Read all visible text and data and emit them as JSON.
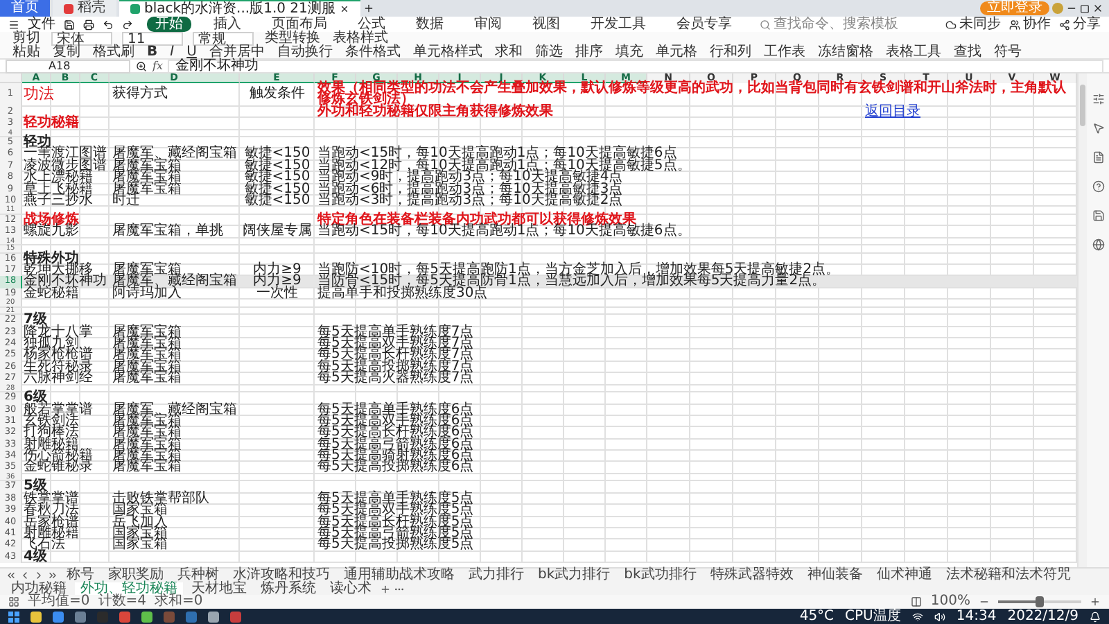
{
  "title_tabs": [
    {
      "label": "首页",
      "selected": false,
      "kind": "home"
    },
    {
      "label": "稻壳",
      "selected": false,
      "kind": "app"
    },
    {
      "label": "black的水浒资...版1.0 21测服",
      "selected": true,
      "kind": "doc"
    }
  ],
  "login_button": "立即登录",
  "menu": {
    "file": "文件",
    "tabs": [
      {
        "label": "开始",
        "selected": true
      },
      {
        "label": "插入",
        "selected": false
      },
      {
        "label": "页面布局",
        "selected": false
      },
      {
        "label": "公式",
        "selected": false
      },
      {
        "label": "数据",
        "selected": false
      },
      {
        "label": "审阅",
        "selected": false
      },
      {
        "label": "视图",
        "selected": false
      },
      {
        "label": "开发工具",
        "selected": false
      },
      {
        "label": "会员专享",
        "selected": false
      }
    ],
    "search": "查找命令、搜索模板",
    "actions": [
      "未同步",
      "协作",
      "分享"
    ]
  },
  "ribbon": {
    "row_1": [
      {
        "kind": "button",
        "label": "剪切"
      },
      {
        "kind": "field",
        "label": "宋体"
      },
      {
        "kind": "field",
        "label": "11"
      },
      {
        "kind": "field",
        "label": "常规"
      },
      {
        "kind": "button",
        "label": "类型转换"
      },
      {
        "kind": "button",
        "label": "表格样式"
      }
    ],
    "row_2": [
      {
        "kind": "button",
        "label": "粘贴"
      },
      {
        "kind": "button",
        "label": "复制"
      },
      {
        "kind": "button",
        "label": "格式刷"
      },
      {
        "kind": "bold",
        "label": "B"
      },
      {
        "kind": "italic",
        "label": "I"
      },
      {
        "kind": "underline",
        "label": "U"
      },
      {
        "kind": "button",
        "label": "合并居中"
      },
      {
        "kind": "button",
        "label": "自动换行"
      },
      {
        "kind": "button",
        "label": "条件格式"
      },
      {
        "kind": "button",
        "label": "单元格样式"
      },
      {
        "kind": "button",
        "label": "求和"
      },
      {
        "kind": "button",
        "label": "筛选"
      },
      {
        "kind": "button",
        "label": "排序"
      },
      {
        "kind": "button",
        "label": "填充"
      },
      {
        "kind": "button",
        "label": "单元格"
      },
      {
        "kind": "button",
        "label": "行和列"
      },
      {
        "kind": "button",
        "label": "工作表"
      },
      {
        "kind": "button",
        "label": "冻结窗格"
      },
      {
        "kind": "button",
        "label": "表格工具"
      },
      {
        "kind": "button",
        "label": "查找"
      },
      {
        "kind": "button",
        "label": "符号"
      }
    ]
  },
  "formula_bar": {
    "name_box": "A18",
    "function_label": "fx",
    "value": "金刚不坏神功"
  },
  "columns": [
    {
      "label": "A",
      "selected": true
    },
    {
      "label": "B",
      "selected": true
    },
    {
      "label": "C",
      "selected": true
    },
    {
      "label": "D",
      "selected": true
    },
    {
      "label": "E",
      "selected": true
    },
    {
      "label": "F",
      "selected": true
    },
    {
      "label": "G",
      "selected": true
    },
    {
      "label": "H",
      "selected": true
    },
    {
      "label": "I",
      "selected": true
    },
    {
      "label": "J",
      "selected": true
    },
    {
      "label": "K",
      "selected": true
    },
    {
      "label": "L",
      "selected": true
    },
    {
      "label": "M",
      "selected": true
    },
    {
      "label": "N",
      "selected": false
    },
    {
      "label": "O",
      "selected": false
    },
    {
      "label": "P",
      "selected": false
    },
    {
      "label": "Q",
      "selected": false
    },
    {
      "label": "R",
      "selected": false
    },
    {
      "label": "S",
      "selected": false
    },
    {
      "label": "T",
      "selected": false
    },
    {
      "label": "U",
      "selected": false
    },
    {
      "label": "V",
      "selected": false
    },
    {
      "label": "W",
      "selected": false
    }
  ],
  "rows": [
    {
      "num": "1",
      "kind": "title",
      "selected": false,
      "a": "功法",
      "d": "获得方式",
      "e": "触发条件",
      "f": "效果（相同类型的功法不会产生叠加效果，默认修炼等级更高的武功，比如当背包同时有玄铁剑谱和开山斧法时，主角默认修炼玄铁剑法）"
    },
    {
      "num": "2",
      "kind": "link",
      "selected": false,
      "f": "外功和轻功秘籍仅限主角获得修炼效果",
      "link": "返回目录"
    },
    {
      "num": "3",
      "kind": "section",
      "selected": false,
      "a": "轻功秘籍"
    },
    {
      "num": "4",
      "kind": "empty",
      "selected": false
    },
    {
      "num": "5",
      "kind": "group",
      "selected": false,
      "a": "轻功"
    },
    {
      "num": "6",
      "kind": "item",
      "selected": false,
      "a": "一苇渡江图谱",
      "d": "屠魔军、藏经阁宝箱",
      "e": "敏捷<150",
      "f": "当跑动<15时，每10天提高跑动1点；每10天提高敏捷6点"
    },
    {
      "num": "7",
      "kind": "item",
      "selected": false,
      "a": "凌波微步图谱",
      "d": "屠魔军宝箱",
      "e": "敏捷<150",
      "f": "当跑动<12时，每10天提高跑动1点；每10天提高敏捷5点。"
    },
    {
      "num": "8",
      "kind": "item",
      "selected": false,
      "a": "水上漂秘籍",
      "d": "屠魔军宝箱",
      "e": "敏捷<150",
      "f": "当跑动<9时，提高跑动3点；每10天提高敏捷4点"
    },
    {
      "num": "9",
      "kind": "item",
      "selected": false,
      "a": "草上飞秘籍",
      "d": "屠魔军宝箱",
      "e": "敏捷<150",
      "f": "当跑动<6时，提高跑动3点；每10天提高敏捷3点"
    },
    {
      "num": "10",
      "kind": "item",
      "selected": false,
      "a": "燕子三抄水",
      "d": "时迁",
      "e": "敏捷<150",
      "f": "当跑动<3时，提高跑动3点；每10天提高敏捷2点"
    },
    {
      "num": "11",
      "kind": "empty",
      "selected": false
    },
    {
      "num": "12",
      "kind": "section",
      "selected": false,
      "a": "战场修炼",
      "f": "特定角色在装备栏装备内功武功都可以获得修炼效果"
    },
    {
      "num": "13",
      "kind": "item",
      "selected": false,
      "a": "螺旋九影",
      "d": "屠魔军宝箱，单挑",
      "e": "阔侠屋专属",
      "f": "当跑动<15时，每10天提高跑动1点；每10天提高敏捷6点。"
    },
    {
      "num": "14",
      "kind": "empty",
      "selected": false
    },
    {
      "num": "15",
      "kind": "empty",
      "selected": false
    },
    {
      "num": "16",
      "kind": "group",
      "selected": false,
      "a": "特殊外功"
    },
    {
      "num": "17",
      "kind": "item",
      "selected": false,
      "a": "乾坤大挪移",
      "d": "屠魔军宝箱",
      "e": "内力≥9",
      "f": "当跑防<10时，每5天提高跑防1点，当方金芝加入后，增加效果每5天提高敏捷2点。"
    },
    {
      "num": "18",
      "kind": "item",
      "selected": true,
      "a": "金刚不坏神功",
      "d": "屠魔军、藏经阁宝箱",
      "e": "内力≥9",
      "f": "当防骨<15时，每5天提高防骨1点，当慧远加入后，增加效果每5天提高力量2点。"
    },
    {
      "num": "19",
      "kind": "item",
      "selected": false,
      "a": "金蛇秘籍",
      "d": "阿诗玛加入",
      "e": "一次性",
      "f": "提高单手和投掷熟练度30点"
    },
    {
      "num": "20",
      "kind": "empty",
      "selected": false
    },
    {
      "num": "21",
      "kind": "empty",
      "selected": false
    },
    {
      "num": "22",
      "kind": "group",
      "selected": false,
      "a": "7级"
    },
    {
      "num": "23",
      "kind": "item",
      "selected": false,
      "a": "降龙十八掌",
      "d": "屠魔军宝箱",
      "f": "每5天提高单手熟练度7点"
    },
    {
      "num": "24",
      "kind": "item",
      "selected": false,
      "a": "独孤九剑",
      "d": "屠魔军宝箱",
      "f": "每5天提高双手熟练度7点"
    },
    {
      "num": "25",
      "kind": "item",
      "selected": false,
      "a": "杨家枪枪谱",
      "d": "屠魔军宝箱",
      "f": "每5天提高长杆熟练度7点"
    },
    {
      "num": "26",
      "kind": "item",
      "selected": false,
      "a": "生死符秘录",
      "d": "屠魔军宝箱",
      "f": "每5天提高投掷熟练度7点"
    },
    {
      "num": "27",
      "kind": "item",
      "selected": false,
      "a": "六脉神剑经",
      "d": "屠魔军宝箱",
      "f": "每5天提高火器熟练度7点"
    },
    {
      "num": "28",
      "kind": "empty",
      "selected": false
    },
    {
      "num": "29",
      "kind": "group",
      "selected": false,
      "a": "6级"
    },
    {
      "num": "30",
      "kind": "item",
      "selected": false,
      "a": "般若掌掌谱",
      "d": "屠魔军、藏经阁宝箱",
      "f": "每5天提高单手熟练度6点"
    },
    {
      "num": "31",
      "kind": "item",
      "selected": false,
      "a": "玄铁剑法",
      "d": "屠魔军宝箱",
      "f": "每5天提高双手熟练度6点"
    },
    {
      "num": "32",
      "kind": "item",
      "selected": false,
      "a": "打狗棒法",
      "d": "屠魔军宝箱",
      "f": "每5天提高长杆熟练度6点"
    },
    {
      "num": "33",
      "kind": "item",
      "selected": false,
      "a": "射雕秘籍",
      "d": "屠魔军宝箱",
      "f": "每5天提高弓箭熟练度6点"
    },
    {
      "num": "34",
      "kind": "item",
      "selected": false,
      "a": "伤心箭秘籍",
      "d": "屠魔军宝箱",
      "f": "每5天提高骑射熟练度6点"
    },
    {
      "num": "35",
      "kind": "item",
      "selected": false,
      "a": "金蛇锥秘录",
      "d": "屠魔军宝箱",
      "f": "每5天提高投掷熟练度6点"
    },
    {
      "num": "36",
      "kind": "empty",
      "selected": false
    },
    {
      "num": "37",
      "kind": "group",
      "selected": false,
      "a": "5级"
    },
    {
      "num": "38",
      "kind": "item",
      "selected": false,
      "a": "铁掌掌谱",
      "d": "击败铁掌帮部队",
      "f": "每5天提高单手熟练度5点"
    },
    {
      "num": "39",
      "kind": "item",
      "selected": false,
      "a": "春秋刀法",
      "d": "国家宝箱",
      "f": "每5天提高双手熟练度5点"
    },
    {
      "num": "40",
      "kind": "item",
      "selected": false,
      "a": "岳家枪谱",
      "d": "岳飞加入",
      "f": "每5天提高长杆熟练度5点"
    },
    {
      "num": "41",
      "kind": "item",
      "selected": false,
      "a": "射雕秘籍",
      "d": "国家宝箱",
      "f": "每5天提高弓箭熟练度5点"
    },
    {
      "num": "42",
      "kind": "item",
      "selected": false,
      "a": "飞石法",
      "d": "国家宝箱",
      "f": "每5天提高投掷熟练度5点"
    },
    {
      "num": "43",
      "kind": "group",
      "selected": false,
      "a": "4级"
    }
  ],
  "sheet_tabs": [
    {
      "label": "称号",
      "selected": false
    },
    {
      "label": "家职奖励",
      "selected": false
    },
    {
      "label": "兵种树",
      "selected": false
    },
    {
      "label": "水浒攻略和技巧",
      "selected": false
    },
    {
      "label": "通用辅助战术攻略",
      "selected": false
    },
    {
      "label": "武力排行",
      "selected": false
    },
    {
      "label": "bk武力排行",
      "selected": false
    },
    {
      "label": "bk武功排行",
      "selected": false
    },
    {
      "label": "特殊武器特效",
      "selected": false
    },
    {
      "label": "神仙装备",
      "selected": false
    },
    {
      "label": "仙术神通",
      "selected": false
    },
    {
      "label": "法术秘籍和法术符咒",
      "selected": false
    },
    {
      "label": "内功秘籍",
      "selected": false
    },
    {
      "label": "外功、轻功秘籍",
      "selected": true
    },
    {
      "label": "天材地宝",
      "selected": false
    },
    {
      "label": "炼丹系统",
      "selected": false
    },
    {
      "label": "读心术",
      "selected": false
    }
  ],
  "status_bar": {
    "stats": [
      "平均值=0",
      "计数=4",
      "求和=0"
    ],
    "zoom": "100%",
    "zoom_slider": {
      "level": 0.5
    }
  },
  "taskbar": {
    "temperature": "45°C",
    "sensor": "CPU温度",
    "time": "14:34",
    "date": "2022/12/9"
  }
}
